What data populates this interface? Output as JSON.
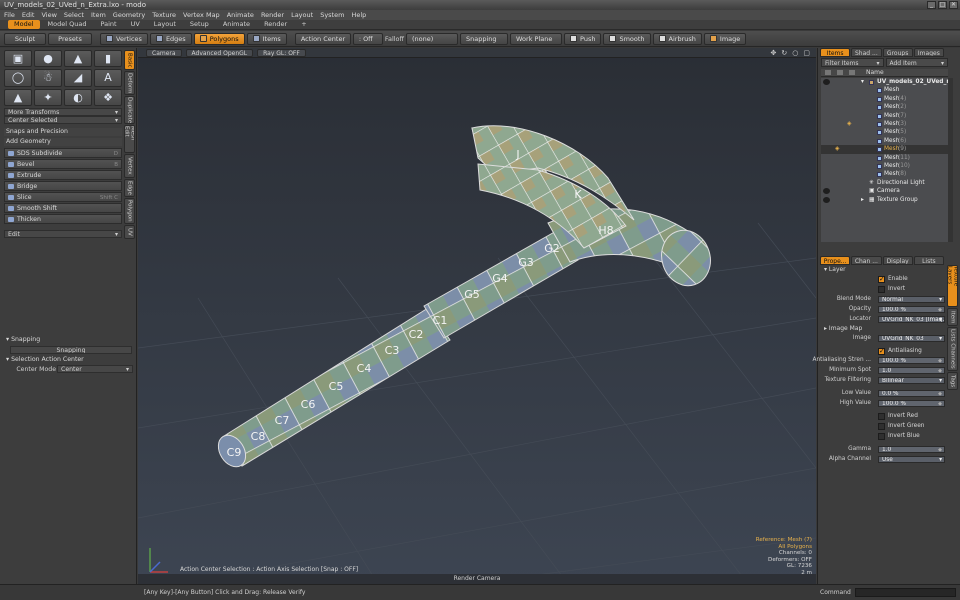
{
  "window": {
    "title": "UV_models_02_UVed_n_Extra.lxo - modo",
    "controls": [
      "_",
      "□",
      "✕"
    ]
  },
  "menu": [
    "File",
    "Edit",
    "View",
    "Select",
    "Item",
    "Geometry",
    "Texture",
    "Vertex Map",
    "Animate",
    "Render",
    "Layout",
    "System",
    "Help"
  ],
  "layout_tabs": [
    "Model",
    "Model Quad",
    "Paint",
    "UV",
    "Layout",
    "Setup",
    "Animate",
    "Render",
    "+"
  ],
  "toolbar": {
    "sculpt": "Sculpt",
    "presets": "Presets",
    "vertices": "Vertices",
    "edges": "Edges",
    "polygons": "Polygons",
    "items": "Items",
    "action_center": "Action Center",
    "symmetry": ": Off",
    "falloff": "Falloff",
    "falloff_value": "(none)",
    "snapping": "Snapping",
    "work_plane": "Work Plane",
    "push": "Push",
    "smooth": "Smooth",
    "airbrush": "Airbrush",
    "image": "Image"
  },
  "left": {
    "vtabs": [
      "Basic",
      "Deform",
      "Duplicate",
      "Mesh Edit",
      "Vertex",
      "Edge",
      "Polygon",
      "UV"
    ],
    "tool_icons": [
      "cube-icon",
      "sphere-icon",
      "cone-icon",
      "cylinder-icon",
      "torus-icon",
      "figure-icon",
      "capsule-icon",
      "text-icon",
      "ring-icon",
      "transform-icon",
      "rotate-icon",
      "scale-icon"
    ],
    "more_transforms": "More Transforms",
    "center_selected": "Center Selected",
    "snaps_precision": "Snaps and Precision",
    "add_geometry": "Add Geometry",
    "tools": [
      {
        "label": "SDS Subdivide",
        "shortcut": "D"
      },
      {
        "label": "Bevel",
        "shortcut": "B"
      },
      {
        "label": "Extrude",
        "shortcut": ""
      },
      {
        "label": "Bridge",
        "shortcut": ""
      },
      {
        "label": "Slice",
        "shortcut": "Shift C"
      },
      {
        "label": "Smooth Shift",
        "shortcut": ""
      },
      {
        "label": "Thicken",
        "shortcut": ""
      }
    ],
    "edit": "Edit",
    "snapping_head": "Snapping",
    "snapping_btn": "Snapping",
    "sel_action_center": "Selection Action Center",
    "center_mode_label": "Center Mode",
    "center_mode_value": "Center"
  },
  "viewport": {
    "header": [
      "Camera",
      "Advanced OpenGL",
      "Ray GL: OFF"
    ],
    "icons": [
      "move-view-icon",
      "rotate-view-icon",
      "zoom-view-icon",
      "maximize-icon"
    ],
    "info": [
      "Reference: Mesh (7)",
      "All Polygons",
      "Channels: 0",
      "Deformers: OFF",
      "GL: 7236",
      "2 m"
    ],
    "hint": "Action Center Selection : Action Axis Selection  [Snap : OFF]",
    "footer": "Render Camera",
    "uv_labels": [
      "C9",
      "C8",
      "C7",
      "C6",
      "C5",
      "C4",
      "C3",
      "C2",
      "C1",
      "G5",
      "G4",
      "G3",
      "G2",
      "H8",
      "J",
      "K"
    ]
  },
  "status": {
    "hint": "[Any Key]-[Any Button] Click and Drag:  Release Verify",
    "command": "Command"
  },
  "right": {
    "tabs": [
      "Items",
      "Shad ...",
      "Groups",
      "Images"
    ],
    "filter": "Filter Items",
    "add": "Add Item",
    "name_col": "Name",
    "scene": "UV_models_02_UVed_n_E",
    "items": [
      {
        "label": "Mesh",
        "suffix": ""
      },
      {
        "label": "Mesh",
        "suffix": "(4)"
      },
      {
        "label": "Mesh",
        "suffix": "(2)"
      },
      {
        "label": "Mesh",
        "suffix": "(7)"
      },
      {
        "label": "Mesh",
        "suffix": "(3)"
      },
      {
        "label": "Mesh",
        "suffix": "(5)"
      },
      {
        "label": "Mesh",
        "suffix": "(6)"
      },
      {
        "label": "Mesh",
        "suffix": "(9)"
      },
      {
        "label": "Mesh",
        "suffix": "(11)"
      },
      {
        "label": "Mesh",
        "suffix": "(10)"
      },
      {
        "label": "Mesh",
        "suffix": "(8)"
      }
    ],
    "light": "Directional Light",
    "camera": "Camera",
    "texture_group": "Texture Group",
    "prop_tabs": [
      "Prope...",
      "Chan ...",
      "Display",
      "Lists"
    ],
    "prop_vtabs": [
      "Texture Layers",
      "Item",
      "Lists Channels",
      "Tags"
    ],
    "props": {
      "layer": "Layer",
      "enable": "Enable",
      "invert": "Invert",
      "blend_mode_l": "Blend Mode",
      "blend_mode": "Normal",
      "opacity_l": "Opacity",
      "opacity": "100.0 %",
      "locator_l": "Locator",
      "locator": "UVGrid_NK_03 (Imag...",
      "image_map": "Image Map",
      "image_l": "Image",
      "image": "UVGrid_NK_03",
      "antialiasing": "Antialiasing",
      "aa_strength_l": "Antialiasing Stren ...",
      "aa_strength": "100.0 %",
      "min_spot_l": "Minimum Spot",
      "min_spot": "1.0",
      "tex_filter_l": "Texture Filtering",
      "tex_filter": "Bilinear",
      "low_l": "Low Value",
      "low": "0.0 %",
      "high_l": "High Value",
      "high": "100.0 %",
      "invert_red": "Invert Red",
      "invert_green": "Invert Green",
      "invert_blue": "Invert Blue",
      "gamma_l": "Gamma",
      "gamma": "1.0",
      "alpha_l": "Alpha Channel",
      "alpha": "Use"
    }
  }
}
